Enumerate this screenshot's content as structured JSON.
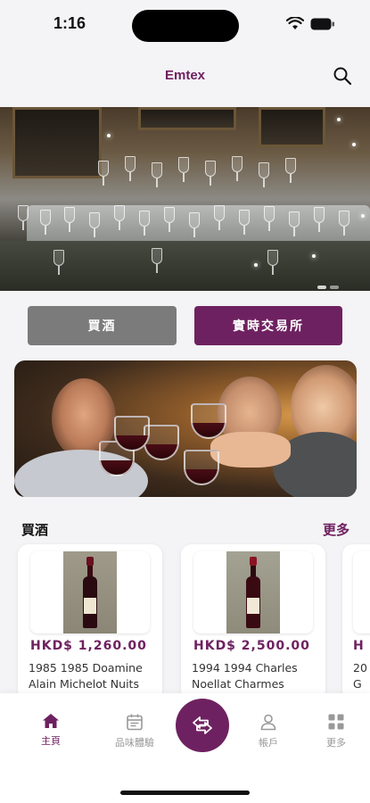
{
  "status_bar": {
    "time": "1:16"
  },
  "header": {
    "title": "Emtex"
  },
  "segments": {
    "buy_label": "買酒",
    "exchange_label": "實時交易所"
  },
  "section": {
    "title": "買酒",
    "more_label": "更多"
  },
  "products": [
    {
      "price": "HKD$ 1,260.00",
      "name": "1985 1985 Doamine Alain Michelot Nuits"
    },
    {
      "price": "HKD$ 2,500.00",
      "name": "1994 1994 Charles Noellat Charmes"
    },
    {
      "price": "H",
      "name": "20 G"
    }
  ],
  "bottom_nav": {
    "home": "主頁",
    "tasting": "品味體驗",
    "account": "帳戶",
    "more": "更多"
  },
  "colors": {
    "brand": "#6e2160",
    "inactive_button": "#7b7b7b"
  },
  "icons": [
    "search-icon",
    "home-icon",
    "calendar-icon",
    "exchange-icon",
    "user-icon",
    "grid-icon",
    "wifi-icon",
    "battery-icon"
  ]
}
